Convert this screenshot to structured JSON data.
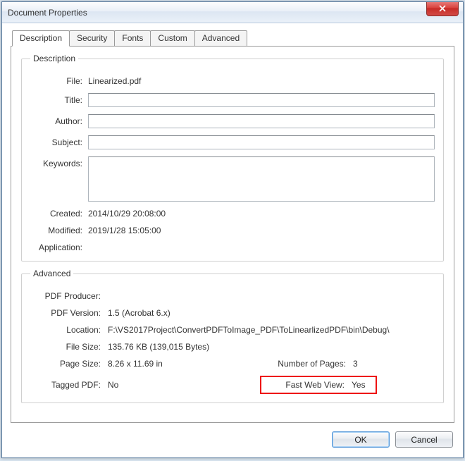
{
  "window": {
    "title": "Document Properties"
  },
  "tabs": [
    {
      "label": "Description"
    },
    {
      "label": "Security"
    },
    {
      "label": "Fonts"
    },
    {
      "label": "Custom"
    },
    {
      "label": "Advanced"
    }
  ],
  "description": {
    "legend": "Description",
    "file_label": "File:",
    "file_value": "Linearized.pdf",
    "title_label": "Title:",
    "title_value": "",
    "author_label": "Author:",
    "author_value": "",
    "subject_label": "Subject:",
    "subject_value": "",
    "keywords_label": "Keywords:",
    "keywords_value": "",
    "created_label": "Created:",
    "created_value": "2014/10/29 20:08:00",
    "modified_label": "Modified:",
    "modified_value": "2019/1/28 15:05:00",
    "application_label": "Application:",
    "application_value": ""
  },
  "advanced": {
    "legend": "Advanced",
    "producer_label": "PDF Producer:",
    "producer_value": "",
    "version_label": "PDF Version:",
    "version_value": "1.5 (Acrobat 6.x)",
    "location_label": "Location:",
    "location_value": "F:\\VS2017Project\\ConvertPDFToImage_PDF\\ToLinearlizedPDF\\bin\\Debug\\",
    "filesize_label": "File Size:",
    "filesize_value": "135.76 KB (139,015 Bytes)",
    "pagesize_label": "Page Size:",
    "pagesize_value": "8.26 x 11.69 in",
    "numpages_label": "Number of Pages:",
    "numpages_value": "3",
    "tagged_label": "Tagged PDF:",
    "tagged_value": "No",
    "fastweb_label": "Fast Web View:",
    "fastweb_value": "Yes"
  },
  "buttons": {
    "ok": "OK",
    "cancel": "Cancel"
  }
}
